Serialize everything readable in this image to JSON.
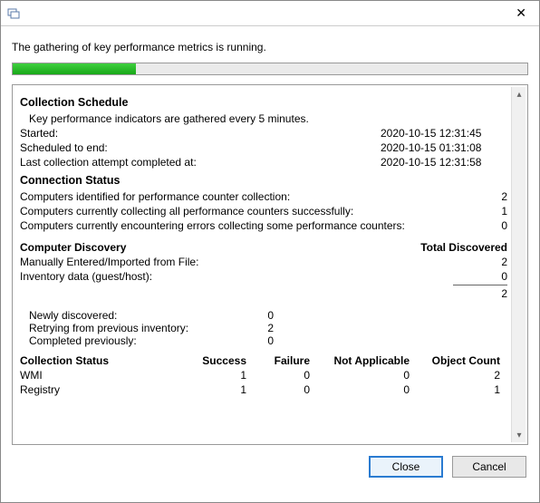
{
  "titlebar": {
    "close_glyph": "✕"
  },
  "status_message": "The gathering of key performance metrics is running.",
  "schedule": {
    "heading": "Collection Schedule",
    "description": "Key performance indicators are gathered every 5 minutes.",
    "started_label": "Started:",
    "started_value": "2020-10-15 12:31:45",
    "end_label": "Scheduled to end:",
    "end_value": "2020-10-15 01:31:08",
    "last_label": "Last collection attempt completed at:",
    "last_value": "2020-10-15 12:31:58"
  },
  "connection": {
    "heading": "Connection Status",
    "identified_label": "Computers identified for performance counter collection:",
    "identified_value": "2",
    "success_label": "Computers currently collecting all performance counters successfully:",
    "success_value": "1",
    "errors_label": "Computers currently encountering errors collecting some performance counters:",
    "errors_value": "0"
  },
  "discovery": {
    "heading": "Computer Discovery",
    "total_heading": "Total Discovered",
    "manual_label": "Manually Entered/Imported from File:",
    "manual_value": "2",
    "inventory_label": "Inventory data (guest/host):",
    "inventory_value": "0",
    "sum_value": "2",
    "newly_label": "Newly discovered:",
    "newly_value": "0",
    "retry_label": "Retrying from previous inventory:",
    "retry_value": "2",
    "completed_label": "Completed previously:",
    "completed_value": "0"
  },
  "collection_status": {
    "heading": "Collection Status",
    "col_success": "Success",
    "col_failure": "Failure",
    "col_na": "Not Applicable",
    "col_obj": "Object Count",
    "rows": [
      {
        "name": "WMI",
        "success": "1",
        "failure": "0",
        "na": "0",
        "obj": "2"
      },
      {
        "name": "Registry",
        "success": "1",
        "failure": "0",
        "na": "0",
        "obj": "1"
      }
    ]
  },
  "buttons": {
    "close": "Close",
    "cancel": "Cancel"
  }
}
